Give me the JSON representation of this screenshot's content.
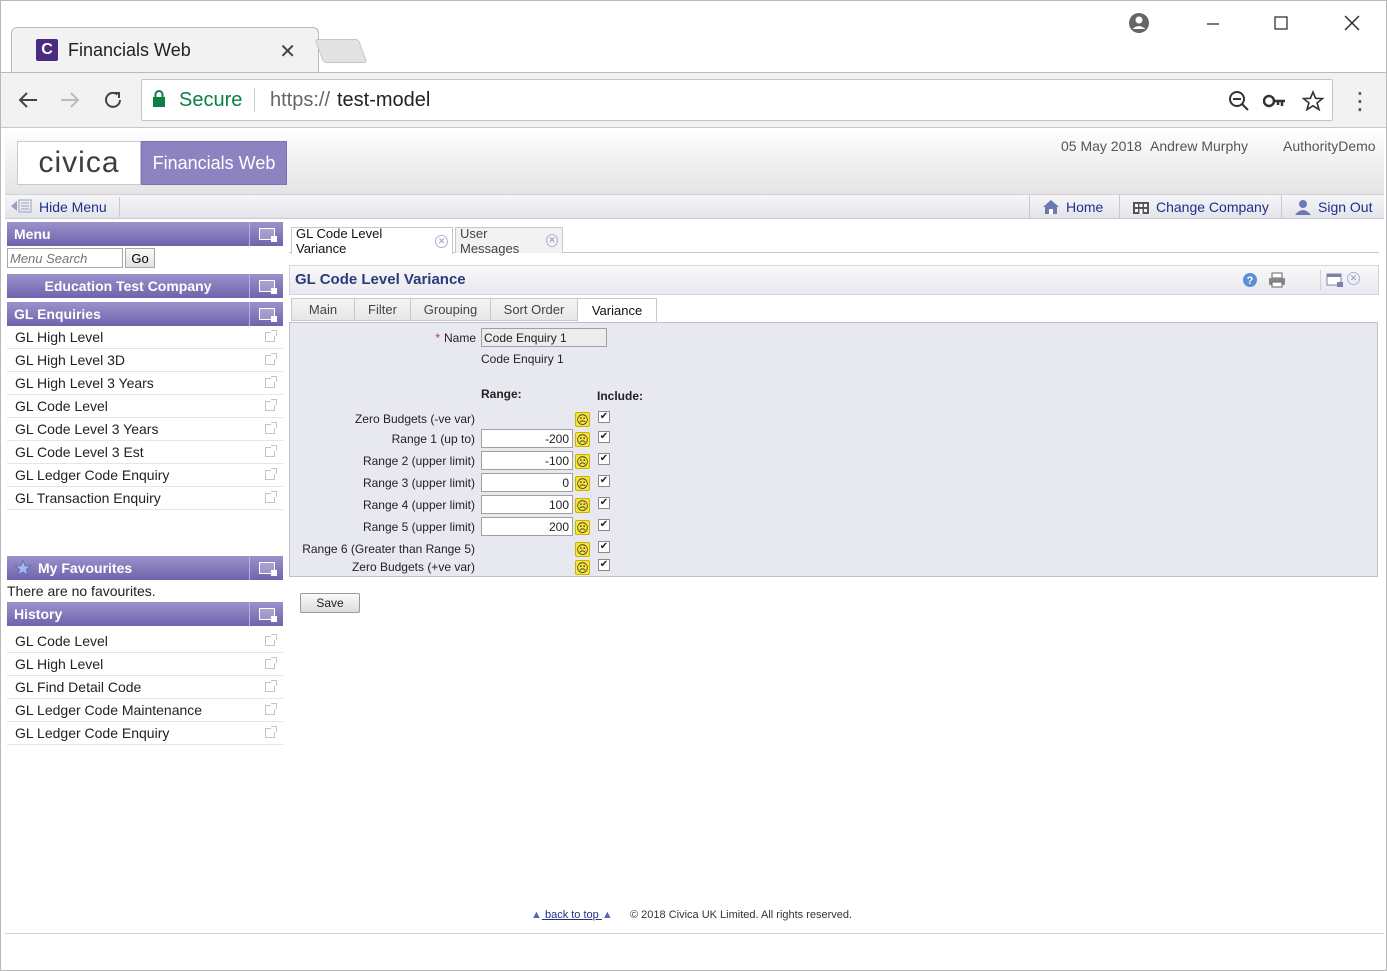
{
  "browser": {
    "tab_title": "Financials Web",
    "tab_favicon_letter": "C",
    "secure_label": "Secure",
    "url_scheme": "https://",
    "url_host": "test-model"
  },
  "header": {
    "logo_text": "civica",
    "product_name": "Financials Web",
    "date": "05 May 2018",
    "user": "Andrew Murphy",
    "authority": "AuthorityDemo"
  },
  "command_bar": {
    "hide_menu": "Hide Menu",
    "home": "Home",
    "change_company": "Change Company",
    "sign_out": "Sign Out"
  },
  "sidebar": {
    "menu_title": "Menu",
    "search_placeholder": "Menu Search",
    "go_label": "Go",
    "company": "Education Test Company",
    "enquiries_title": "GL Enquiries",
    "enquiries": [
      "GL High Level",
      "GL High Level 3D",
      "GL High Level 3 Years",
      "GL Code Level",
      "GL Code Level 3 Years",
      "GL Code Level 3 Est",
      "GL Ledger Code Enquiry",
      "GL Transaction Enquiry"
    ],
    "favourites_title": "My Favourites",
    "no_favourites": "There are no favourites.",
    "history_title": "History",
    "history": [
      "GL Code Level",
      "GL High Level",
      "GL Find Detail Code",
      "GL Ledger Code Maintenance",
      "GL Ledger Code Enquiry"
    ]
  },
  "doc_tabs": [
    {
      "label": "GL Code Level Variance",
      "active": true
    },
    {
      "label": "User Messages",
      "active": false
    }
  ],
  "form": {
    "title": "GL Code Level Variance",
    "sub_tabs": [
      "Main",
      "Filter",
      "Grouping",
      "Sort Order",
      "Variance"
    ],
    "active_sub_tab": "Variance",
    "name_label": "Name",
    "required_mark": "*",
    "name_value": "Code Enquiry 1",
    "name_display": "Code Enquiry 1",
    "range_header": "Range:",
    "include_header": "Include:",
    "rows": [
      {
        "label": "Zero Budgets (-ve var)",
        "value": null,
        "include": true
      },
      {
        "label": "Range 1 (up to)",
        "value": "-200",
        "include": true
      },
      {
        "label": "Range 2 (upper limit)",
        "value": "-100",
        "include": true
      },
      {
        "label": "Range 3 (upper limit)",
        "value": "0",
        "include": true
      },
      {
        "label": "Range 4 (upper limit)",
        "value": "100",
        "include": true
      },
      {
        "label": "Range 5 (upper limit)",
        "value": "200",
        "include": true
      },
      {
        "label": "Range 6 (Greater than Range 5)",
        "value": null,
        "include": true
      },
      {
        "label": "Zero Budgets (+ve var)",
        "value": null,
        "include": true
      }
    ],
    "save_label": "Save"
  },
  "footer": {
    "back_to_top": "back to top",
    "copyright": "© 2018 Civica UK Limited. All rights reserved."
  },
  "colors": {
    "panel_header": "#7a70b6",
    "link": "#1f2f8a",
    "form_bg": "#e8e8f0",
    "face_badge": "#f7e43b"
  }
}
